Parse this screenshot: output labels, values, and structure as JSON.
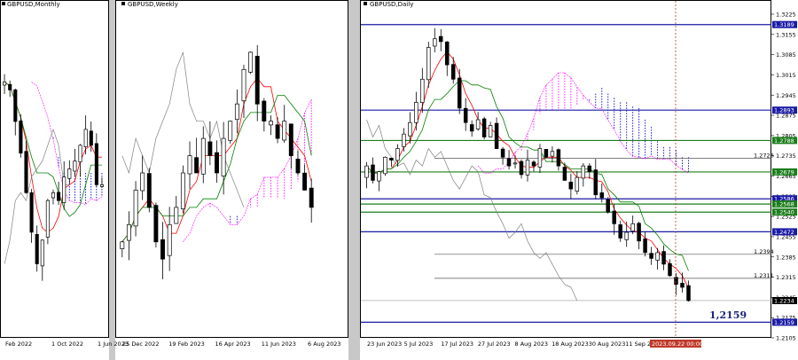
{
  "colors": {
    "bull": "#ffffff",
    "bear": "#000000",
    "tenkan": "#ff0000",
    "kijun": "#008000",
    "chikou": "#808080",
    "kumo_bull": "#ff00ff",
    "kumo_bear": "#0000cc",
    "level_blue": "#1a1aa6",
    "level_green": "#1b7d1b",
    "price_label": "#000000",
    "time_label": "#c0392b"
  },
  "chart_data": [
    {
      "type": "candlestick",
      "title": "GBPUSD,Monthly",
      "x_ticks": [
        "Feb 2022",
        "1 Oct 2022",
        "1 Jun 2023"
      ],
      "trend_close": [
        1.35,
        1.34,
        1.3,
        1.26,
        1.21,
        1.16,
        1.12,
        1.15,
        1.2,
        1.21,
        1.2,
        1.23,
        1.24,
        1.25,
        1.27,
        1.29,
        1.27,
        1.22,
        1.22
      ],
      "last_value": 1.2234
    },
    {
      "type": "candlestick",
      "title": "GBPUSD,Weekly",
      "x_ticks": [
        "25 Dec 2022",
        "19 Feb 2023",
        "16 Apr 2023",
        "11 Jun 2023",
        "6 Aug 2023"
      ],
      "trend_close": [
        1.2,
        1.21,
        1.23,
        1.24,
        1.22,
        1.2,
        1.19,
        1.21,
        1.22,
        1.24,
        1.25,
        1.24,
        1.26,
        1.25,
        1.24,
        1.26,
        1.27,
        1.28,
        1.3,
        1.31,
        1.28,
        1.27,
        1.27,
        1.26,
        1.27,
        1.25,
        1.24,
        1.23,
        1.22
      ],
      "last_value": 1.2234
    },
    {
      "type": "candlestick",
      "title": "GBPUSD,Daily",
      "x_ticks": [
        "23 Jun 2023",
        "5 Jul 2023",
        "17 Jul 2023",
        "27 Jul 2023",
        "8 Aug 2023",
        "18 Aug 2023",
        "30 Aug 2023",
        "11 Sep 2023",
        "2023.09.22 00:00"
      ],
      "y_ticks": [
        "1.3225",
        "1.3155",
        "1.3085",
        "1.3015",
        "1.2945",
        "1.2875",
        "1.2805",
        "1.2735",
        "1.2665",
        "1.2595",
        "1.2525",
        "1.2455",
        "1.2385",
        "1.2315",
        "1.2245",
        "1.2175",
        "1.2105"
      ],
      "ylim": [
        1.2105,
        1.3225
      ],
      "trend_close": [
        1.27,
        1.265,
        1.268,
        1.273,
        1.272,
        1.276,
        1.281,
        1.285,
        1.292,
        1.3,
        1.311,
        1.314,
        1.313,
        1.305,
        1.3,
        1.29,
        1.285,
        1.282,
        1.286,
        1.28,
        1.284,
        1.276,
        1.273,
        1.27,
        1.271,
        1.267,
        1.272,
        1.27,
        1.276,
        1.273,
        1.275,
        1.27,
        1.265,
        1.262,
        1.266,
        1.27,
        1.268,
        1.26,
        1.259,
        1.254,
        1.25,
        1.245,
        1.247,
        1.25,
        1.244,
        1.24,
        1.238,
        1.24,
        1.236,
        1.232,
        1.229,
        1.228,
        1.2234
      ],
      "levels": [
        {
          "value": 1.3189,
          "label": "1.3189",
          "kind": "blue"
        },
        {
          "value": 1.2893,
          "label": "1.2893",
          "kind": "blue"
        },
        {
          "value": 1.2788,
          "label": "1.2788",
          "kind": "green"
        },
        {
          "value": 1.2726,
          "label": "1.2726",
          "kind": "plain"
        },
        {
          "value": 1.2679,
          "label": "1.2679",
          "kind": "green"
        },
        {
          "value": 1.2586,
          "label": "1.2586",
          "kind": "blue"
        },
        {
          "value": 1.2568,
          "label": "1.2568",
          "kind": "green"
        },
        {
          "value": 1.254,
          "label": "1.2540",
          "kind": "green"
        },
        {
          "value": 1.2472,
          "label": "1.2472",
          "kind": "blue"
        },
        {
          "value": 1.2394,
          "label": "1.2394",
          "kind": "plain"
        },
        {
          "value": 1.2311,
          "label": "1.2311",
          "kind": "plain"
        },
        {
          "value": 1.2234,
          "label": "1.2234",
          "kind": "price"
        },
        {
          "value": 1.2159,
          "label": "1.2159",
          "kind": "blue"
        }
      ],
      "annotation": "1,2159",
      "last_value": 1.2234
    }
  ]
}
